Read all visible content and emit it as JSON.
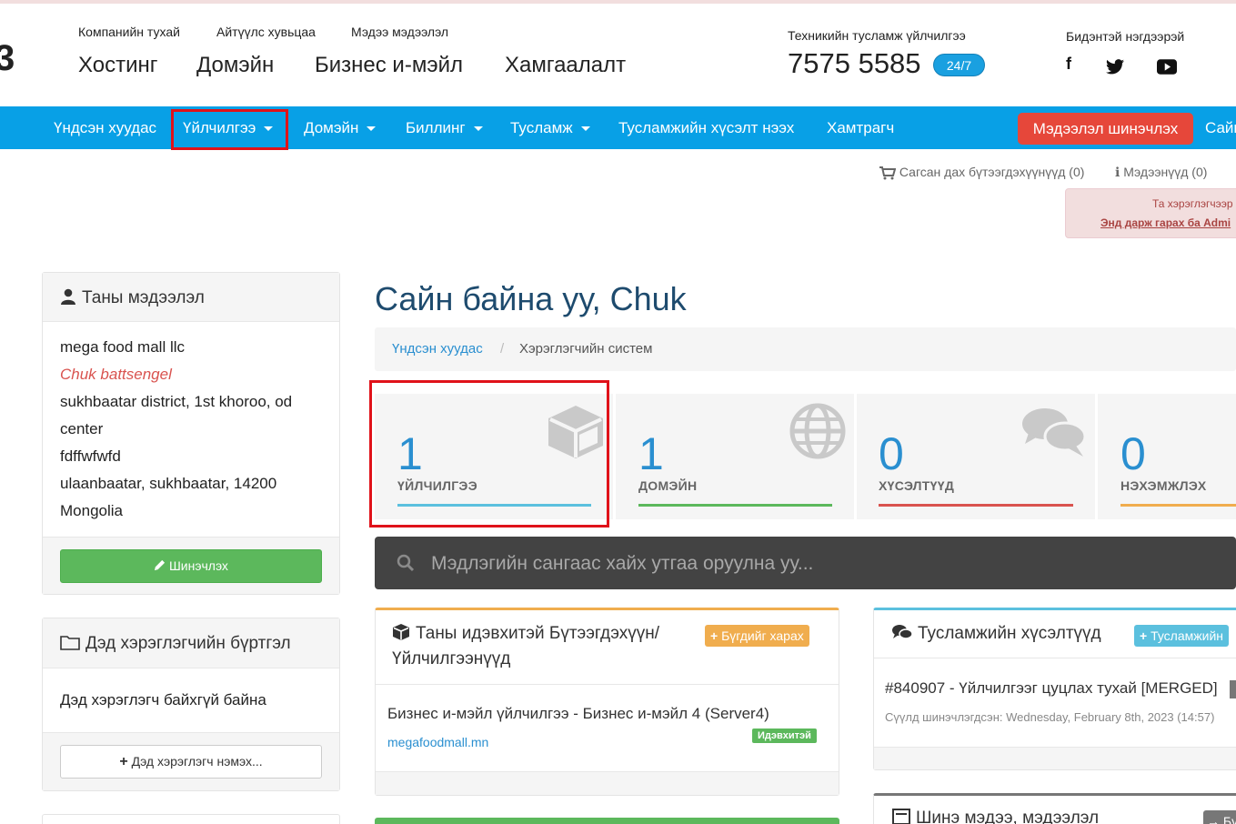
{
  "header": {
    "logo_fragment": "3",
    "sub_links": [
      "Компанийн тухай",
      "Айтүүлс хувьцаа",
      "Мэдээ мэдээлэл"
    ],
    "main_links": [
      "Хостинг",
      "Домэйн",
      "Бизнес и-мэйл",
      "Хамгаалалт"
    ],
    "support_label": "Техникийн тусламж үйлчилгээ",
    "phone": "7575 5585",
    "support_badge": "24/7",
    "contact_label": "Бидэнтэй нэгдээрэй",
    "social": [
      "f",
      "twitter",
      "youtube"
    ]
  },
  "navbar": {
    "items": [
      "Үндсэн хуудас",
      "Үйлчилгээ",
      "Домэйн",
      "Биллинг",
      "Тусламж",
      "Тусламжийн хүсэлт нээх",
      "Хамтрагч"
    ],
    "update_button": "Мэдээлэл шинэчлэх",
    "cut_item": "Сайн"
  },
  "utility": {
    "cart": "Сагсан дах бүтээгдэхүүнүүд (0)",
    "notices": "Мэдээнүүд (0)"
  },
  "alert": {
    "line1": "Та хэрэглэгчээр",
    "line2": "Энд дарж гарах ба Admi"
  },
  "sidebar": {
    "info_title": "Таны мэдээлэл",
    "company": "mega food mall llc",
    "name": "Chuk battsengel",
    "address_lines": [
      "sukhbaatar district, 1st khoroo, od",
      "center",
      "fdffwfwfd",
      "ulaanbaatar, sukhbaatar, 14200",
      "Mongolia"
    ],
    "update_button": "Шинэчлэх",
    "sub_title": "Дэд хэрэглэгчийн бүртгэл",
    "no_sub": "Дэд хэрэглэгч байхгүй байна",
    "add_sub_button": "Дэд хэрэглэгч нэмэх..."
  },
  "main": {
    "welcome": "Сайн байна уу, Chuk",
    "breadcrumb": {
      "home": "Үндсэн хуудас",
      "separator": "/",
      "current": "Хэрэглэгчийн систем"
    },
    "tiles": [
      {
        "value": "1",
        "label": "ҮЙЛЧИЛГЭЭ",
        "color": "#5bc0de",
        "icon": "cube-icon"
      },
      {
        "value": "1",
        "label": "ДОМЭЙН",
        "color": "#5cb85c",
        "icon": "globe-icon"
      },
      {
        "value": "0",
        "label": "ХҮСЭЛТҮҮД",
        "color": "#d9534f",
        "icon": "comments-icon"
      },
      {
        "value": "0",
        "label": "НЭХЭМЖЛЭХ",
        "color": "#f0ad4e",
        "icon": "credit-card-icon"
      }
    ],
    "search_placeholder": "Мэдлэгийн сангаас хайх утгаа оруулна уу...",
    "products_card": {
      "title_line1": "Таны идэвхитэй Бүтээгдэхүүн/",
      "title_line2": "Үйлчилгээнүүд",
      "view_all": "Бүгдийг харах",
      "item_name": "Бизнес и-мэйл үйлчилгээ - Бизнес и-мэйл 4 (Server4)",
      "item_domain": "megafoodmall.mn",
      "item_status": "Идэвхитэй"
    },
    "tickets_card": {
      "title": "Тусламжийн хүсэлтүүд",
      "button": "Тусламжийн",
      "ticket_title": "#840907 - Үйлчилгээг цуцлах тухай [MERGED]",
      "ticket_updated": "Сүүлд шинэчлэгдсэн: Wednesday, February 8th, 2023 (14:57)"
    },
    "news_card": {
      "title": "Шинэ мэдээ, мэдээлэл",
      "button": "Бү"
    }
  }
}
